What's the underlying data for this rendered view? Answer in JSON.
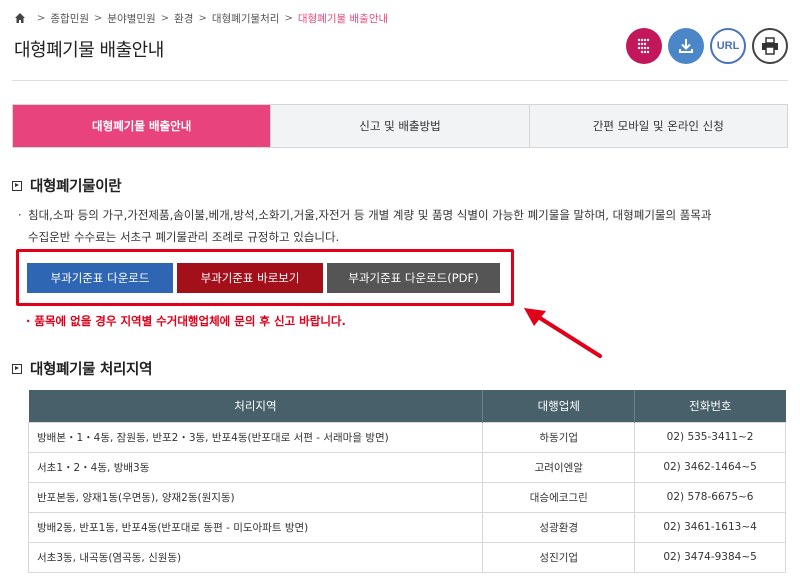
{
  "breadcrumb": {
    "items": [
      "종합민원",
      "분야별민원",
      "환경",
      "대형폐기물처리"
    ],
    "current": "대형폐기물 배출안내"
  },
  "page": {
    "title": "대형폐기물 배출안내"
  },
  "actions": {
    "url_label": "URL"
  },
  "tabs": [
    {
      "label": "대형폐기물 배출안내",
      "active": true
    },
    {
      "label": "신고 및 배출방법",
      "active": false
    },
    {
      "label": "간편 모바일 및 온라인 신청",
      "active": false
    }
  ],
  "section1": {
    "heading": "대형폐기물이란",
    "bullet": "·",
    "desc_line1": "침대,소파 등의 가구,가전제품,솜이불,베개,방석,소화기,거울,자전거 등 개별 계량 및 품명 식별이 가능한 폐기물을 말하며, 대형폐기물의 품목과",
    "desc_line2": "수집운반 수수료는 서초구 폐기물관리 조례로 규정하고 있습니다.",
    "buttons": {
      "download": "부과기준표 다운로드",
      "view": "부과기준표 바로보기",
      "download_pdf": "부과기준표 다운로드(PDF)"
    },
    "notice": "· 품목에 없을 경우 지역별 수거대행업체에 문의 후 신고 바랍니다."
  },
  "section2": {
    "heading": "대형폐기물 처리지역",
    "table": {
      "headers": [
        "처리지역",
        "대행업체",
        "전화번호"
      ],
      "rows": [
        [
          "방배본・1・4동, 잠원동, 반포2・3동, 반포4동(반포대로 서편 - 서래마을 방면)",
          "하동기업",
          "02) 535-3411~2"
        ],
        [
          "서초1・2・4동, 방배3동",
          "고려이엔알",
          "02) 3462-1464~5"
        ],
        [
          "반포본동, 양재1동(우면동), 양재2동(원지동)",
          "대승에코그린",
          "02) 578-6675~6"
        ],
        [
          "방배2동, 반포1동, 반포4동(반포대로 동편 - 미도아파트 방면)",
          "성광환경",
          "02) 3461-1613~4"
        ],
        [
          "서초3동, 내곡동(염곡동, 신원동)",
          "성진기업",
          "02) 3474-9384~5"
        ]
      ]
    }
  },
  "colors": {
    "accent_pink": "#e8437c",
    "button_blue": "#2f66b3",
    "button_red": "#a3101a",
    "button_gray": "#555555",
    "highlight_red": "#e0001a",
    "table_header": "#47606a"
  }
}
